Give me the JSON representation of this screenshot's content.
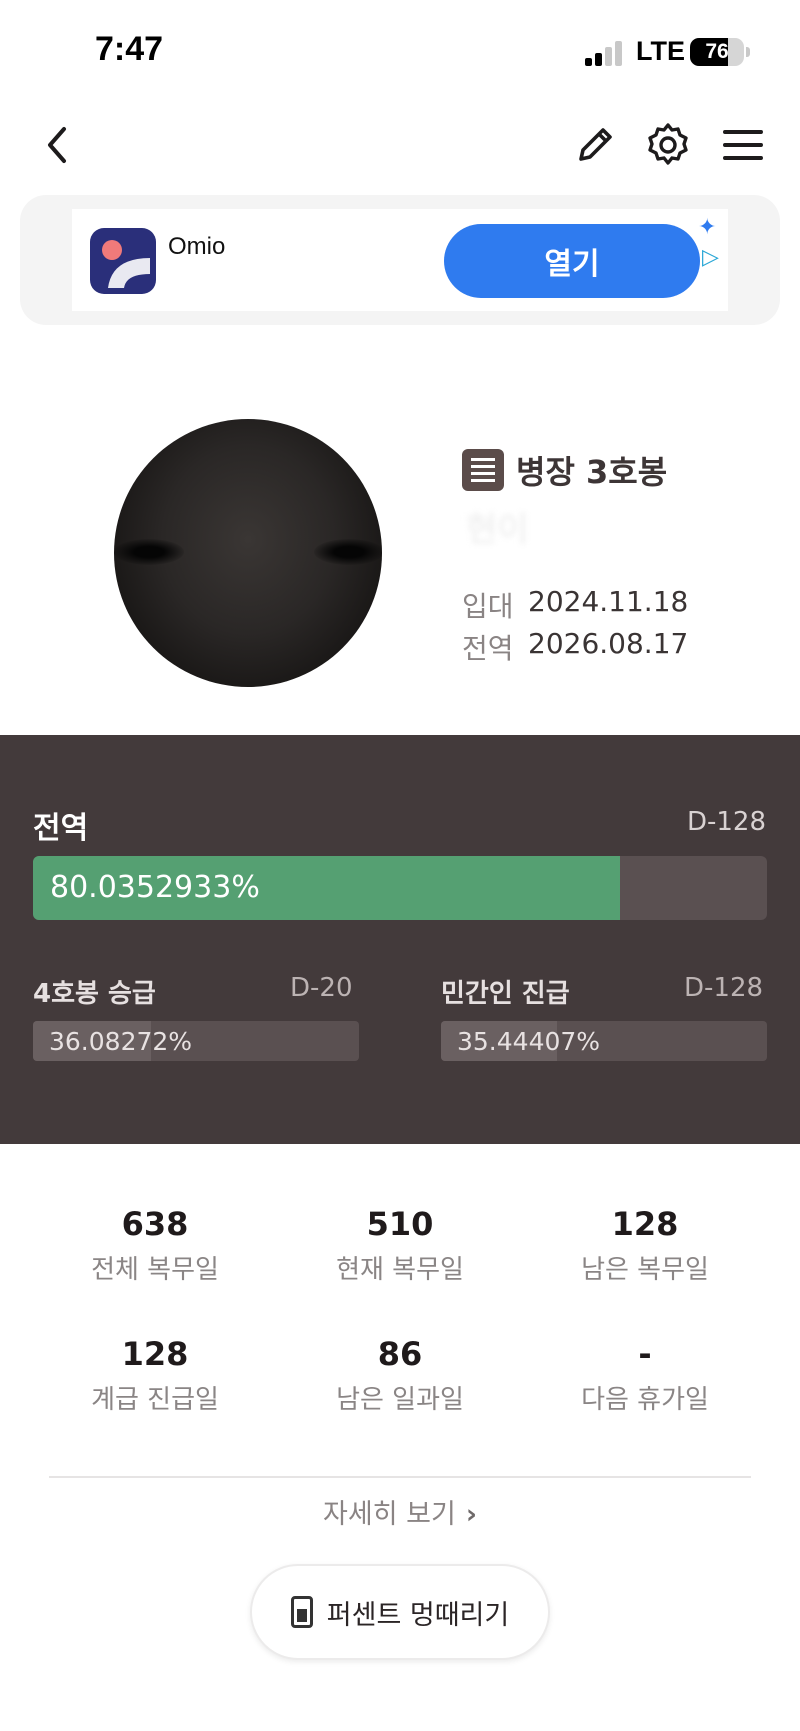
{
  "status_bar": {
    "time": "7:47",
    "network": "LTE",
    "battery": "76"
  },
  "ad": {
    "app_name": "Omio",
    "open_label": "열기",
    "spark_icon": "sparkle-icon",
    "choice_icon": "adchoices-icon"
  },
  "profile": {
    "rank": "병장 3호봉",
    "name": "현이",
    "enlist_label": "입대",
    "enlist_date": "2024.11.18",
    "discharge_label": "전역",
    "discharge_date": "2026.08.17"
  },
  "progress": {
    "main": {
      "title": "전역",
      "dday": "D-128",
      "percent_label": "80.0352933%",
      "percent": 80.0352933,
      "fill_color": "#55a072"
    },
    "promotion": {
      "title": "4호봉 승급",
      "dday": "D-20",
      "percent_label": "36.08272%",
      "percent": 36.08272
    },
    "civilian": {
      "title": "민간인 진급",
      "dday": "D-128",
      "percent_label": "35.44407%",
      "percent": 35.44407
    }
  },
  "stats": [
    {
      "value": "638",
      "label": "전체 복무일"
    },
    {
      "value": "510",
      "label": "현재 복무일"
    },
    {
      "value": "128",
      "label": "남은 복무일"
    },
    {
      "value": "128",
      "label": "계급 진급일"
    },
    {
      "value": "86",
      "label": "남은 일과일"
    },
    {
      "value": "-",
      "label": "다음 휴가일"
    }
  ],
  "detail_link": "자세히 보기",
  "idle_button": "퍼센트 멍때리기",
  "colors": {
    "panel_bg": "#433a3b",
    "accent_blue": "#2f7bef",
    "progress_green": "#55a072"
  }
}
